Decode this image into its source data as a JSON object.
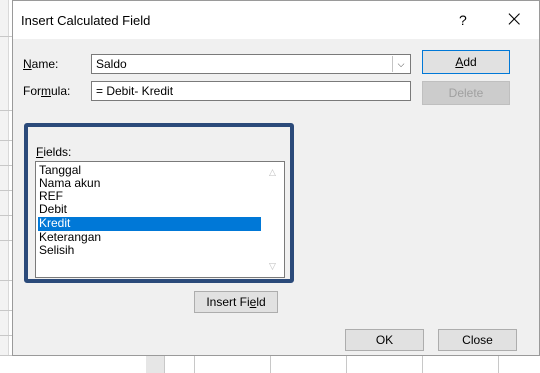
{
  "dialog": {
    "title": "Insert Calculated Field",
    "help": "?",
    "close_glyph": "×"
  },
  "name": {
    "label_first": "N",
    "label_rest": "ame:",
    "value": "Saldo"
  },
  "formula": {
    "label_pre": "For",
    "label_ul": "m",
    "label_post": "ula:",
    "value": "= Debit- Kredit"
  },
  "buttons": {
    "add_pre": "",
    "add_ul": "A",
    "add_post": "dd",
    "delete": "Delete",
    "insert_pre": "Insert Fi",
    "insert_ul": "e",
    "insert_post": "ld",
    "ok": "OK",
    "close": "Close"
  },
  "fields": {
    "label_first": "F",
    "label_rest": "ields:",
    "items": [
      "Tanggal",
      "Nama akun",
      "REF",
      "Debit",
      "Kredit",
      "Keterangan",
      "Selisih"
    ],
    "selected": "Kredit"
  },
  "icons": {
    "dropdown": "chevron-down-icon",
    "scroll_up": "chevron-up-icon",
    "scroll_down": "chevron-down-icon"
  }
}
